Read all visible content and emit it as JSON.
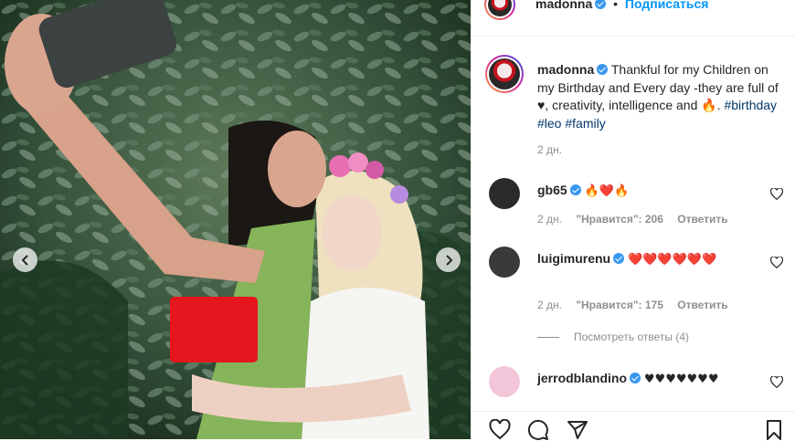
{
  "post": {
    "author": "madonna",
    "follow_label": "Подписаться",
    "separator": "•",
    "caption_text": "Thankful for my Children on my Birthday and Every day -they are full of ♥, creativity, intelligence and 🔥.",
    "hashtags": [
      "#birthday",
      "#leo",
      "#family"
    ],
    "caption_time": "2 дн."
  },
  "comments": [
    {
      "user": "gb65",
      "verified": true,
      "text": "🔥❤️🔥",
      "time": "2 дн.",
      "likes": "\"Нравится\": 206",
      "reply": "Ответить",
      "avatar_color": "#2b2b2b"
    },
    {
      "user": "luigimurenu",
      "verified": true,
      "text": "❤️❤️❤️❤️❤️❤️",
      "time": "2 дн.",
      "likes": "\"Нравится\": 175",
      "reply": "Ответить",
      "avatar_color": "#3a3a3a"
    },
    {
      "user": "jerrodblandino",
      "verified": true,
      "text": "♥♥♥♥♥♥♥",
      "time": "",
      "likes": "",
      "reply": "",
      "avatar_color": "#f2c6d8"
    }
  ],
  "view_replies": "Посмотреть ответы (4)",
  "icons": {
    "prev": "chevron-left-icon",
    "next": "chevron-right-icon",
    "like": "heart-icon",
    "comment": "comment-icon",
    "share": "share-icon",
    "save": "bookmark-icon"
  },
  "colors": {
    "link": "#0095f6",
    "hashtag": "#00376b",
    "verified": "#3897f0",
    "meta": "#8e8e8e",
    "heart": "#ed4956"
  }
}
